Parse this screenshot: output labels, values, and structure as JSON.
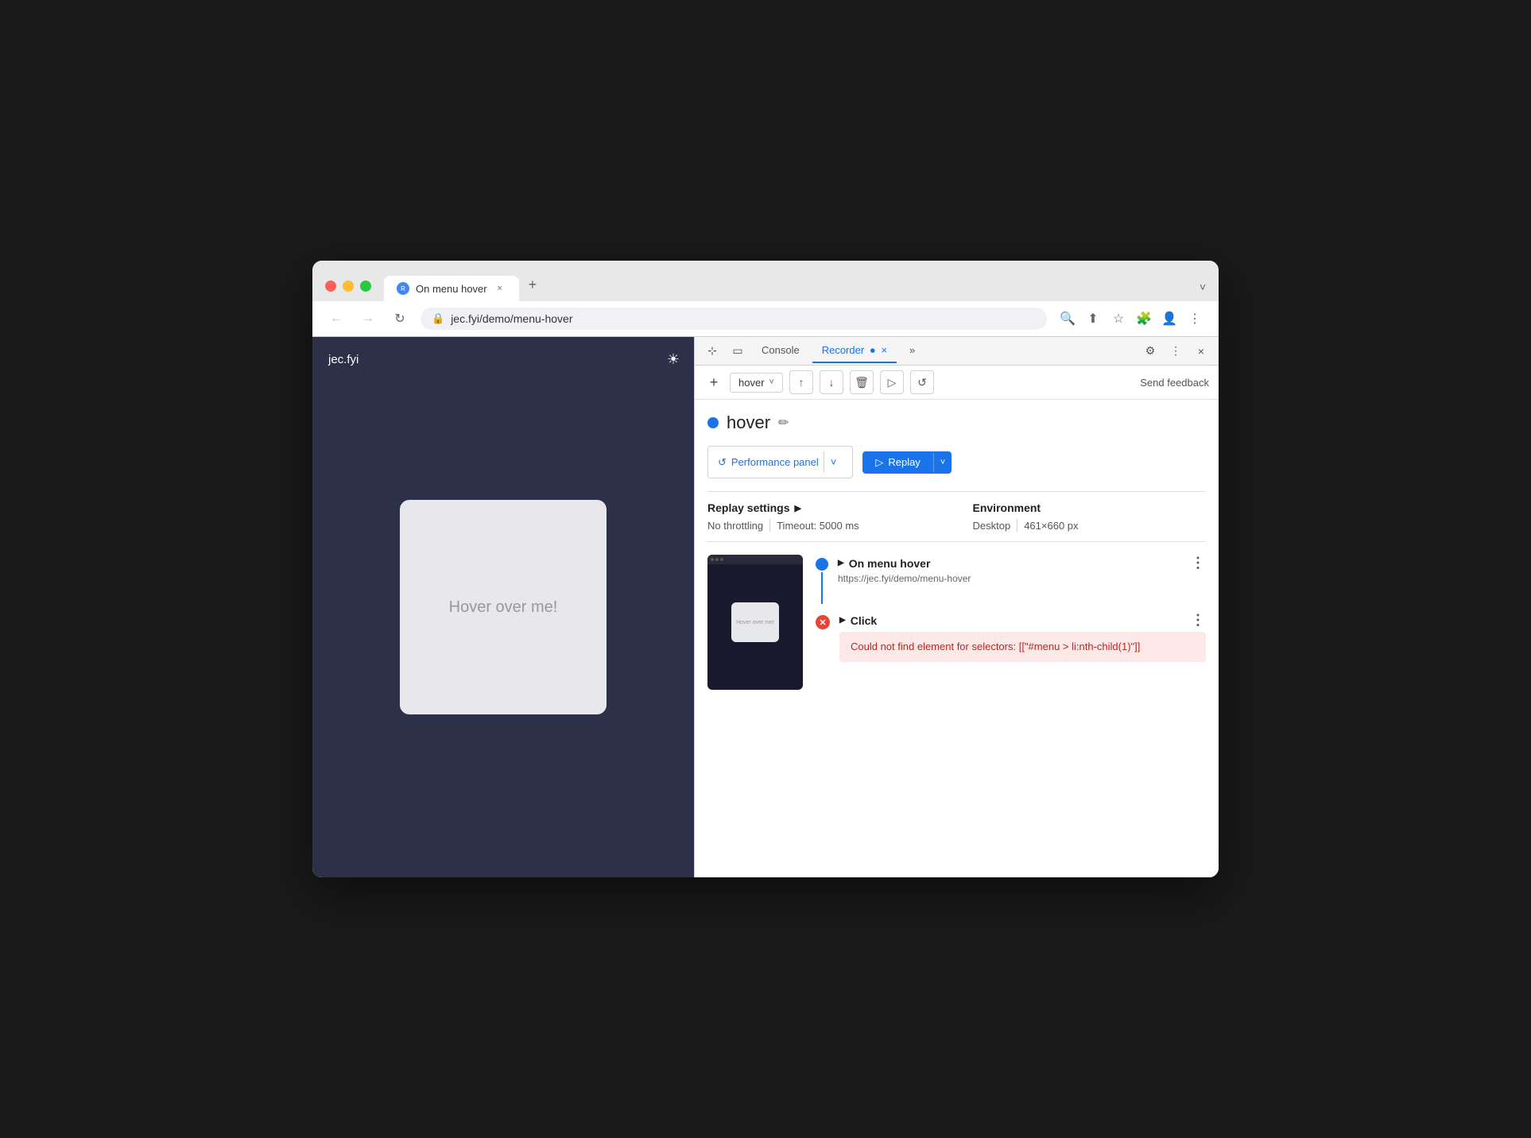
{
  "browser": {
    "traffic_lights": [
      "red",
      "yellow",
      "green"
    ],
    "tab": {
      "title": "On menu hover",
      "close_label": "×"
    },
    "tab_new": "+",
    "tab_dropdown": "˅",
    "address": {
      "url": "jec.fyi/demo/menu-hover",
      "lock_icon": "🔒"
    },
    "nav": {
      "back": "←",
      "forward": "→",
      "reload": "↻"
    }
  },
  "page": {
    "logo": "jec.fyi",
    "brightness_icon": "☀",
    "hover_card_text": "Hover over me!"
  },
  "devtools": {
    "tabs": [
      "Console",
      "Recorder",
      ""
    ],
    "recorder_tab": "Recorder",
    "console_tab": "Console",
    "close_label": "×",
    "more_label": "»",
    "settings_icon": "⚙",
    "more_icon": "⋮",
    "action_bar": {
      "add_label": "+",
      "recording_name": "hover",
      "dropdown_arrow": "˅",
      "export_icon": "↑",
      "import_icon": "↓",
      "delete_icon": "🗑",
      "step_icon": "▷",
      "slow_icon": "↺",
      "send_feedback": "Send feedback"
    },
    "recording": {
      "dot_color": "#1a73e8",
      "name": "hover",
      "edit_icon": "✏"
    },
    "perf_panel": {
      "icon": "↺",
      "label": "Performance panel",
      "dropdown": "˅"
    },
    "replay_btn": {
      "icon": "▷",
      "label": "Replay",
      "dropdown": "˅"
    },
    "settings": {
      "title": "Replay settings",
      "arrow": "▶",
      "throttling": "No throttling",
      "timeout": "Timeout: 5000 ms",
      "env_title": "Environment",
      "env_type": "Desktop",
      "env_size": "461×660 px"
    },
    "steps": [
      {
        "type": "navigate",
        "title": "On menu hover",
        "url": "https://jec.fyi/demo/menu-hover",
        "status": "blue"
      },
      {
        "type": "click",
        "title": "Click",
        "status": "error",
        "error": "Could not find element for selectors: [[\"#menu > li:nth-child(1)\"]]"
      }
    ]
  }
}
